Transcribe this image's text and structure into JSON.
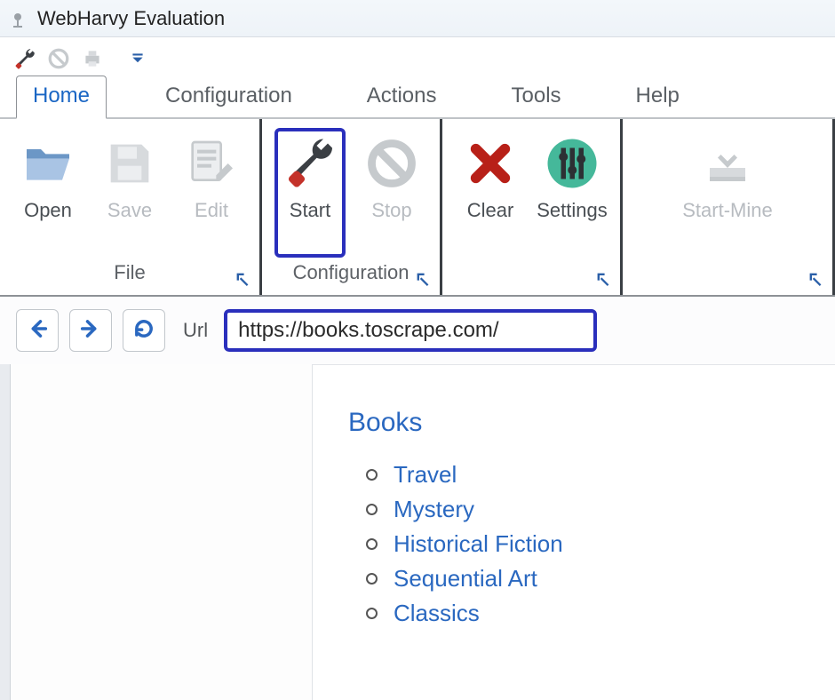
{
  "window": {
    "title": "WebHarvy Evaluation"
  },
  "qat": {
    "icons": [
      "wrench-icon",
      "prohibit-icon",
      "printer-icon"
    ]
  },
  "menu": {
    "tabs": [
      {
        "label": "Home",
        "active": true
      },
      {
        "label": "Configuration",
        "active": false
      },
      {
        "label": "Actions",
        "active": false
      },
      {
        "label": "Tools",
        "active": false
      },
      {
        "label": "Help",
        "active": false
      }
    ]
  },
  "ribbon": {
    "groups": [
      {
        "caption": "File",
        "buttons": [
          {
            "key": "open",
            "label": "Open",
            "enabled": true,
            "highlighted": false
          },
          {
            "key": "save",
            "label": "Save",
            "enabled": false,
            "highlighted": false
          },
          {
            "key": "edit",
            "label": "Edit",
            "enabled": false,
            "highlighted": false
          }
        ]
      },
      {
        "caption": "Configuration",
        "buttons": [
          {
            "key": "start",
            "label": "Start",
            "enabled": true,
            "highlighted": true
          },
          {
            "key": "stop",
            "label": "Stop",
            "enabled": false,
            "highlighted": false
          }
        ]
      },
      {
        "caption": "",
        "buttons": [
          {
            "key": "clear",
            "label": "Clear",
            "enabled": true,
            "highlighted": false
          },
          {
            "key": "settings",
            "label": "Settings",
            "enabled": true,
            "highlighted": false
          }
        ]
      },
      {
        "caption": "",
        "buttons": [
          {
            "key": "startmine",
            "label": "Start-Mine",
            "enabled": false,
            "highlighted": false
          }
        ]
      }
    ]
  },
  "browser": {
    "url_label": "Url",
    "url_value": "https://books.toscrape.com/"
  },
  "page": {
    "heading": "Books",
    "categories": [
      "Travel",
      "Mystery",
      "Historical Fiction",
      "Sequential Art",
      "Classics"
    ]
  }
}
